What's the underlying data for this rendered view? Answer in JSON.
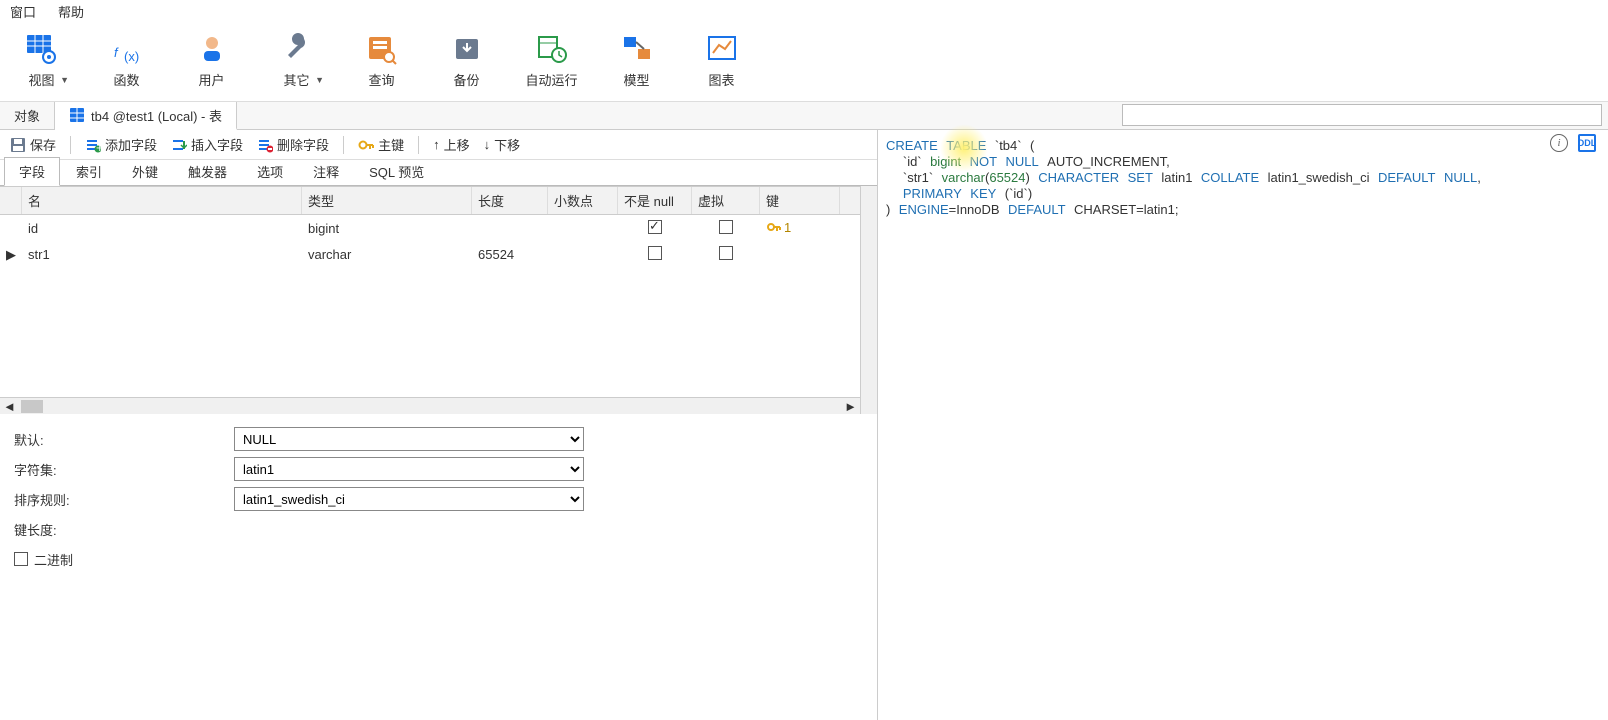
{
  "menu": {
    "window": "窗口",
    "help": "帮助"
  },
  "ribbon": {
    "view": "视图",
    "func": "函数",
    "user": "用户",
    "other": "其它",
    "query": "查询",
    "backup": "备份",
    "auto": "自动运行",
    "model": "模型",
    "chart": "图表"
  },
  "tabs": {
    "objects": "对象",
    "designer": "tb4 @test1 (Local) - 表"
  },
  "filter_placeholder": "",
  "toolbar": {
    "save": "保存",
    "add_field": "添加字段",
    "insert_field": "插入字段",
    "delete_field": "删除字段",
    "pk": "主键",
    "move_up": "上移",
    "move_down": "下移"
  },
  "subtabs": {
    "fields": "字段",
    "indexes": "索引",
    "fk": "外键",
    "triggers": "触发器",
    "options": "选项",
    "comment": "注释",
    "sql": "SQL 预览"
  },
  "grid_headers": {
    "name": "名",
    "type": "类型",
    "length": "长度",
    "decimals": "小数点",
    "notnull": "不是 null",
    "virtual": "虚拟",
    "key": "键"
  },
  "rows": [
    {
      "name": "id",
      "type": "bigint",
      "length": "",
      "decimals": "",
      "notnull": true,
      "virtual": false,
      "key": "1",
      "selected": false
    },
    {
      "name": "str1",
      "type": "varchar",
      "length": "65524",
      "decimals": "",
      "notnull": false,
      "virtual": false,
      "key": "",
      "selected": true
    }
  ],
  "props": {
    "default_label": "默认:",
    "default_value": "NULL",
    "charset_label": "字符集:",
    "charset_value": "latin1",
    "collation_label": "排序规则:",
    "collation_value": "latin1_swedish_ci",
    "keylen_label": "键长度:",
    "binary_label": "二进制"
  },
  "sql": {
    "tokens": {
      "create": "CREATE",
      "table": "TABLE",
      "tbname": "`tb4`",
      "lparen": "(",
      "id_col": "`id`",
      "bigint": "bigint",
      "not": "NOT",
      "null": "NULL",
      "autoinc": "AUTO_INCREMENT,",
      "str1_col": "`str1`",
      "varchar": "varchar",
      "len_open": "(",
      "len": "65524",
      "len_close": ")",
      "charset": "CHARACTER",
      "set": "SET",
      "latin1": "latin1",
      "collate": "COLLATE",
      "collation": "latin1_swedish_ci",
      "default": "DEFAULT",
      "null2": "NULL",
      ",": ",",
      "pk": "PRIMARY",
      "key": "KEY",
      "pk_col": "(`id`)",
      "rparen": ")",
      "engine": "ENGINE",
      "eq": "=",
      "innodb": "InnoDB",
      "default2": "DEFAULT",
      "charset2": "CHARSET=latin1;"
    }
  }
}
